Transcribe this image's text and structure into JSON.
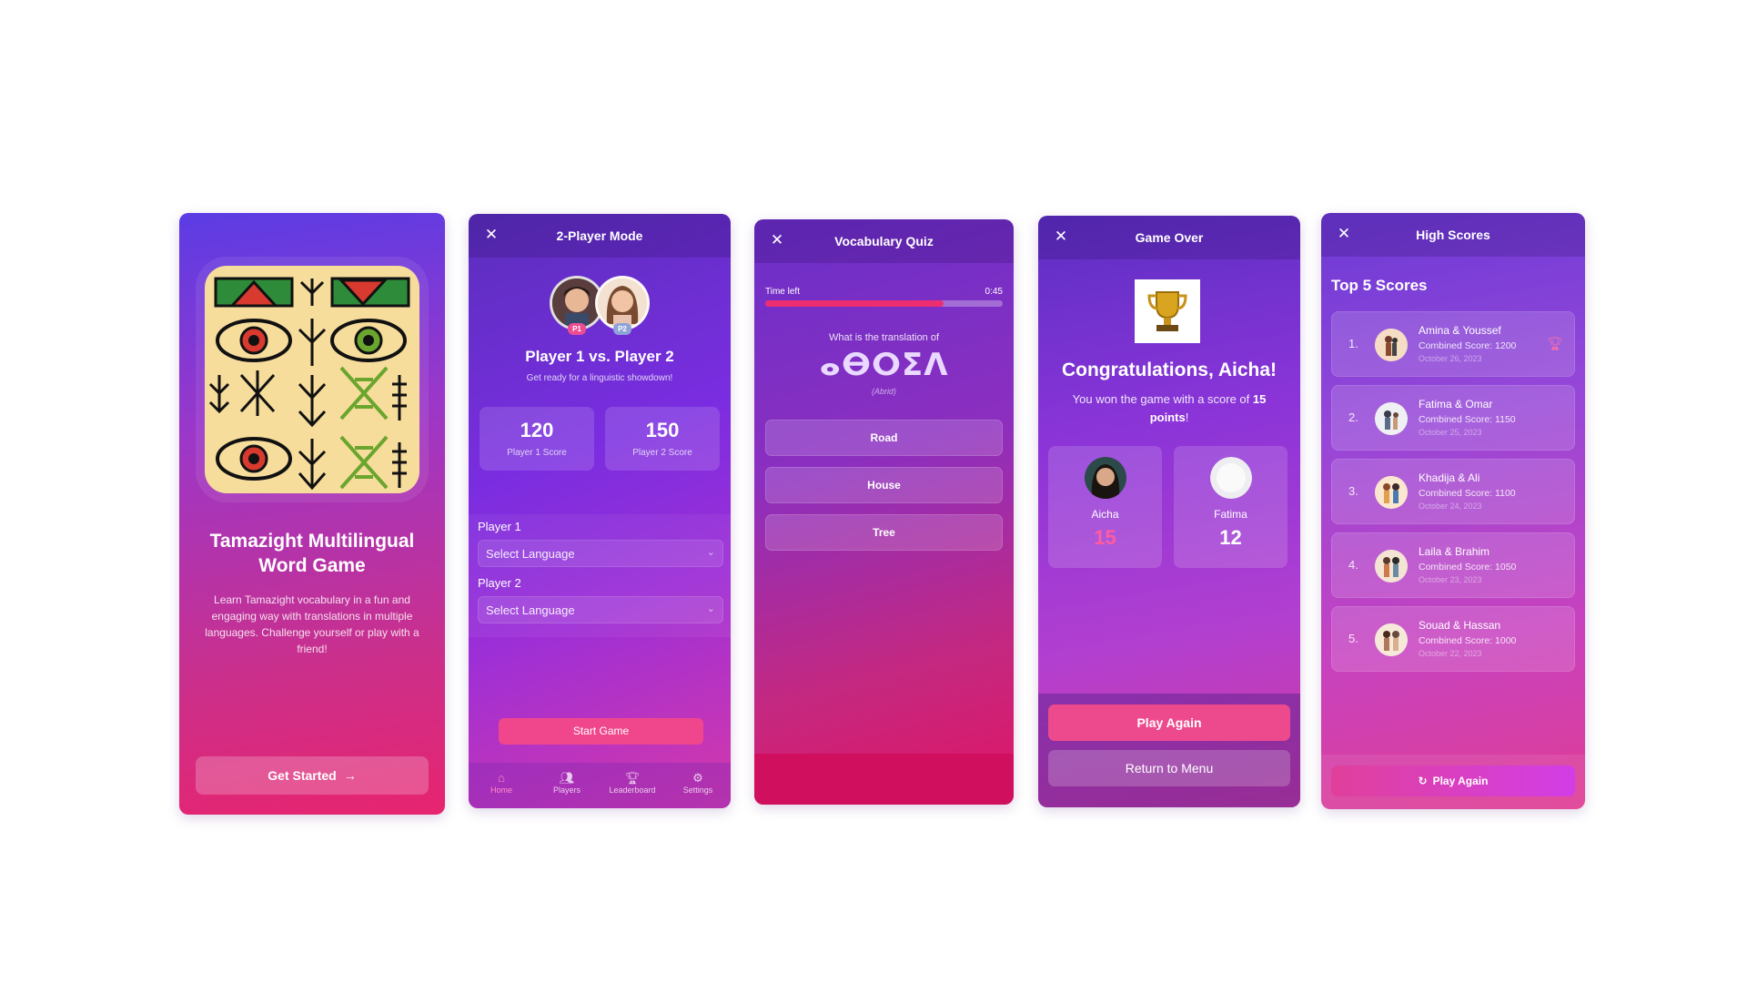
{
  "welcome": {
    "title": "Tamazight Multilingual Word Game",
    "description": "Learn Tamazight vocabulary in a fun and engaging way with translations in multiple languages. Challenge yourself or play with a friend!",
    "cta_label": "Get Started",
    "cta_icon": "arrow-right-icon"
  },
  "two_player": {
    "title": "2-Player Mode",
    "p1_tag": "P1",
    "p2_tag": "P2",
    "versus": "Player 1 vs. Player 2",
    "subtitle": "Get ready for a linguistic showdown!",
    "scores": [
      {
        "value": "120",
        "label": "Player 1 Score"
      },
      {
        "value": "150",
        "label": "Player 2 Score"
      }
    ],
    "player1_label": "Player 1",
    "player2_label": "Player 2",
    "select_placeholder": "Select Language",
    "start_label": "Start Game",
    "nav": [
      {
        "label": "Home",
        "icon": "home-icon",
        "active": true
      },
      {
        "label": "Players",
        "icon": "users-icon",
        "active": false
      },
      {
        "label": "Leaderboard",
        "icon": "trophy-icon",
        "active": false
      },
      {
        "label": "Settings",
        "icon": "gear-icon",
        "active": false
      }
    ],
    "accent": "#f0478c"
  },
  "quiz": {
    "title": "Vocabulary Quiz",
    "time_label": "Time left",
    "time_value": "0:45",
    "time_progress": 0.75,
    "question": "What is the translation of",
    "word": "ⴰⴱⵔⵉⴷ",
    "script_note": "(Abrid)",
    "options": [
      "Road",
      "House",
      "Tree"
    ]
  },
  "game_over": {
    "title": "Game Over",
    "congrats": "Congratulations, Aicha!",
    "won_prefix": "You won the game with a score of ",
    "won_score": "15 points",
    "won_suffix": "!",
    "players": [
      {
        "name": "Aicha",
        "score": "15",
        "score_color": "#ff5c9e"
      },
      {
        "name": "Fatima",
        "score": "12",
        "score_color": "#ffffff"
      }
    ],
    "play_again": "Play Again",
    "return_menu": "Return to Menu"
  },
  "high_scores": {
    "title": "High Scores",
    "heading": "Top 5 Scores",
    "rows": [
      {
        "rank": "1.",
        "names": "Amina & Youssef",
        "score": "Combined Score: 1200",
        "date": "October 26, 2023"
      },
      {
        "rank": "2.",
        "names": "Fatima & Omar",
        "score": "Combined Score: 1150",
        "date": "October 25, 2023"
      },
      {
        "rank": "3.",
        "names": "Khadija & Ali",
        "score": "Combined Score: 1100",
        "date": "October 24, 2023"
      },
      {
        "rank": "4.",
        "names": "Laila & Brahim",
        "score": "Combined Score: 1050",
        "date": "October 23, 2023"
      },
      {
        "rank": "5.",
        "names": "Souad & Hassan",
        "score": "Combined Score: 1000",
        "date": "October 22, 2023"
      }
    ],
    "play_again": "Play Again"
  }
}
